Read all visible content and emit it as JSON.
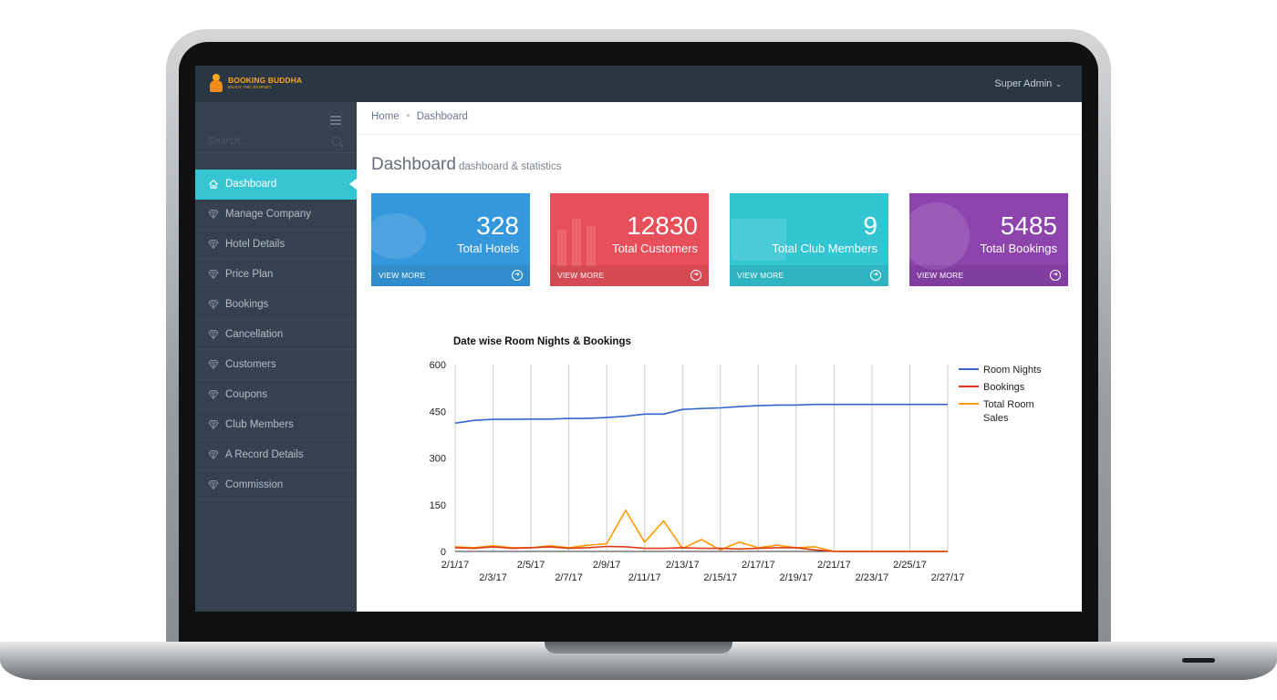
{
  "brand": {
    "title": "BOOKING BUDDHA",
    "tagline": "ENJOY THE JOURNEY"
  },
  "header": {
    "user": "Super Admin"
  },
  "sidebar": {
    "search_placeholder": "Search...",
    "items": [
      {
        "label": "Dashboard",
        "icon": "home-icon",
        "active": true
      },
      {
        "label": "Manage Company",
        "icon": "diamond-icon"
      },
      {
        "label": "Hotel Details",
        "icon": "diamond-icon"
      },
      {
        "label": "Price Plan",
        "icon": "diamond-icon"
      },
      {
        "label": "Bookings",
        "icon": "diamond-icon"
      },
      {
        "label": "Cancellation",
        "icon": "diamond-icon"
      },
      {
        "label": "Customers",
        "icon": "diamond-icon"
      },
      {
        "label": "Coupons",
        "icon": "diamond-icon"
      },
      {
        "label": "Club Members",
        "icon": "diamond-icon"
      },
      {
        "label": "A Record Details",
        "icon": "diamond-icon"
      },
      {
        "label": "Commission",
        "icon": "diamond-icon"
      }
    ]
  },
  "breadcrumb": [
    "Home",
    "Dashboard"
  ],
  "page": {
    "title": "Dashboard",
    "subtitle": "dashboard & statistics"
  },
  "stats": [
    {
      "value": "328",
      "label": "Total Hotels",
      "more": "VIEW MORE",
      "color": "#3598dc"
    },
    {
      "value": "12830",
      "label": "Total Customers",
      "more": "VIEW MORE",
      "color": "#e7505a"
    },
    {
      "value": "9",
      "label": "Total Club Members",
      "more": "VIEW MORE",
      "color": "#32c5d2"
    },
    {
      "value": "5485",
      "label": "Total Bookings",
      "more": "VIEW MORE",
      "color": "#8e44ad"
    }
  ],
  "chart_data": {
    "type": "line",
    "title": "Date wise Room Nights & Bookings",
    "xlabel": "",
    "ylabel": "",
    "ylim": [
      0,
      600
    ],
    "yticks": [
      0,
      150,
      300,
      450,
      600
    ],
    "x": [
      "2/1/17",
      "2/2/17",
      "2/3/17",
      "2/4/17",
      "2/5/17",
      "2/6/17",
      "2/7/17",
      "2/8/17",
      "2/9/17",
      "2/10/17",
      "2/11/17",
      "2/12/17",
      "2/13/17",
      "2/14/17",
      "2/15/17",
      "2/16/17",
      "2/17/17",
      "2/18/17",
      "2/19/17",
      "2/20/17",
      "2/21/17",
      "2/22/17",
      "2/23/17",
      "2/24/17",
      "2/25/17",
      "2/26/17",
      "2/27/17"
    ],
    "xtick_labels": [
      "2/1/17",
      "2/3/17",
      "2/5/17",
      "2/7/17",
      "2/9/17",
      "2/11/17",
      "2/13/17",
      "2/15/17",
      "2/17/17",
      "2/19/17",
      "2/21/17",
      "2/23/17",
      "2/25/17",
      "2/27/17"
    ],
    "grid": "vertical",
    "legend_position": "right",
    "series": [
      {
        "name": "Room Nights",
        "color": "#3366cc",
        "values": [
          412,
          421,
          424,
          424,
          425,
          425,
          427,
          427,
          430,
          434,
          441,
          441,
          456,
          459,
          461,
          465,
          468,
          470,
          470,
          472,
          472,
          472,
          472,
          472,
          472,
          472,
          472
        ]
      },
      {
        "name": "Bookings",
        "color": "#dc3912",
        "values": [
          12,
          10,
          15,
          10,
          12,
          15,
          10,
          12,
          16,
          15,
          10,
          10,
          12,
          10,
          10,
          8,
          10,
          12,
          12,
          5,
          0,
          0,
          0,
          0,
          0,
          0,
          0
        ]
      },
      {
        "name": "Total Room Sales",
        "color": "#ff9900",
        "values": [
          15,
          12,
          18,
          12,
          12,
          18,
          12,
          20,
          25,
          132,
          30,
          98,
          10,
          38,
          5,
          30,
          12,
          20,
          12,
          15,
          0,
          0,
          0,
          0,
          0,
          0,
          0
        ]
      }
    ]
  }
}
